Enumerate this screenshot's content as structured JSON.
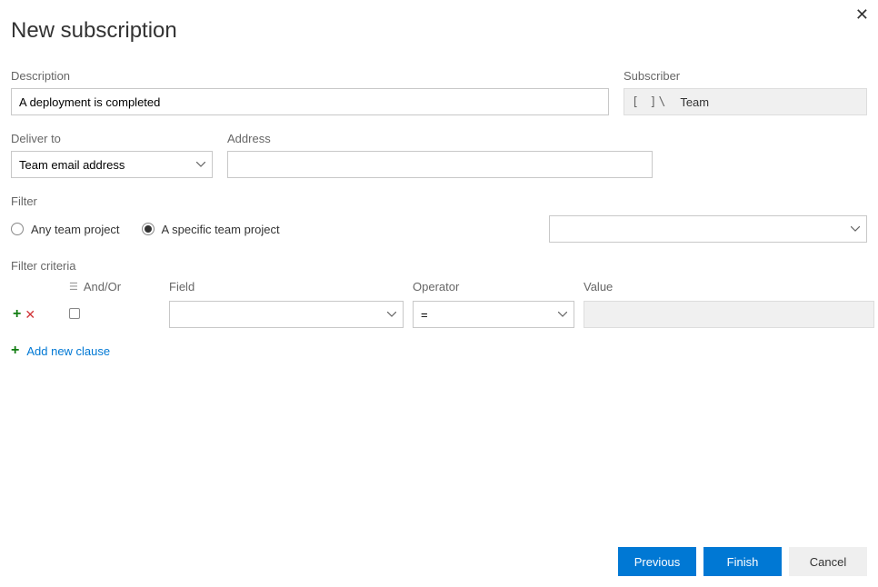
{
  "title": "New subscription",
  "labels": {
    "description": "Description",
    "subscriber": "Subscriber",
    "deliver_to": "Deliver to",
    "address": "Address",
    "filter": "Filter",
    "filter_criteria": "Filter criteria",
    "andor": "And/Or",
    "field": "Field",
    "operator": "Operator",
    "value": "Value"
  },
  "description_value": "A deployment is completed",
  "subscriber": {
    "icon_text": "[  ]\\",
    "name": "Team"
  },
  "deliver_to_value": "Team email address",
  "address_value": "",
  "filter_options": {
    "any": "Any team project",
    "specific": "A specific team project",
    "selected": "specific"
  },
  "project_select_value": "",
  "criteria_row": {
    "field": "",
    "operator": "=",
    "value": ""
  },
  "add_clause_label": "Add new clause",
  "buttons": {
    "previous": "Previous",
    "finish": "Finish",
    "cancel": "Cancel"
  }
}
